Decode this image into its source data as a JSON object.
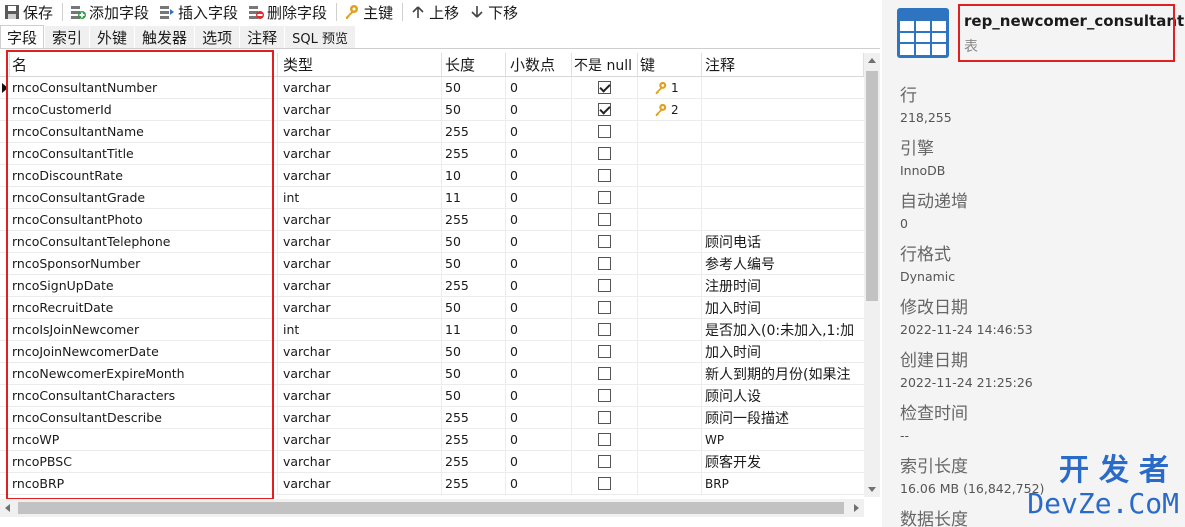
{
  "toolbar": {
    "save": "保存",
    "add_field": "添加字段",
    "insert_field": "插入字段",
    "delete_field": "删除字段",
    "primary_key": "主键",
    "move_up": "上移",
    "move_down": "下移"
  },
  "tabs": [
    "字段",
    "索引",
    "外键",
    "触发器",
    "选项",
    "注释",
    "SQL 预览"
  ],
  "columns": {
    "name": "名",
    "type": "类型",
    "length": "长度",
    "decimals": "小数点",
    "not_null": "不是 null",
    "key": "键",
    "comment": "注释"
  },
  "rows": [
    {
      "name": "rncoConsultantNumber",
      "type": "varchar",
      "length": "50",
      "decimals": "0",
      "not_null": true,
      "key": "1",
      "comment": ""
    },
    {
      "name": "rncoCustomerId",
      "type": "varchar",
      "length": "50",
      "decimals": "0",
      "not_null": true,
      "key": "2",
      "comment": ""
    },
    {
      "name": "rncoConsultantName",
      "type": "varchar",
      "length": "255",
      "decimals": "0",
      "not_null": false,
      "key": "",
      "comment": ""
    },
    {
      "name": "rncoConsultantTitle",
      "type": "varchar",
      "length": "255",
      "decimals": "0",
      "not_null": false,
      "key": "",
      "comment": ""
    },
    {
      "name": "rncoDiscountRate",
      "type": "varchar",
      "length": "10",
      "decimals": "0",
      "not_null": false,
      "key": "",
      "comment": ""
    },
    {
      "name": "rncoConsultantGrade",
      "type": "int",
      "length": "11",
      "decimals": "0",
      "not_null": false,
      "key": "",
      "comment": ""
    },
    {
      "name": "rncoConsultantPhoto",
      "type": "varchar",
      "length": "255",
      "decimals": "0",
      "not_null": false,
      "key": "",
      "comment": ""
    },
    {
      "name": "rncoConsultantTelephone",
      "type": "varchar",
      "length": "50",
      "decimals": "0",
      "not_null": false,
      "key": "",
      "comment": "顾问电话"
    },
    {
      "name": "rncoSponsorNumber",
      "type": "varchar",
      "length": "50",
      "decimals": "0",
      "not_null": false,
      "key": "",
      "comment": "参考人编号"
    },
    {
      "name": "rncoSignUpDate",
      "type": "varchar",
      "length": "255",
      "decimals": "0",
      "not_null": false,
      "key": "",
      "comment": "注册时间"
    },
    {
      "name": "rncoRecruitDate",
      "type": "varchar",
      "length": "50",
      "decimals": "0",
      "not_null": false,
      "key": "",
      "comment": "加入时间"
    },
    {
      "name": "rncoIsJoinNewcomer",
      "type": "int",
      "length": "11",
      "decimals": "0",
      "not_null": false,
      "key": "",
      "comment": "是否加入(0:未加入,1:加"
    },
    {
      "name": "rncoJoinNewcomerDate",
      "type": "varchar",
      "length": "50",
      "decimals": "0",
      "not_null": false,
      "key": "",
      "comment": "加入时间"
    },
    {
      "name": "rncoNewcomerExpireMonth",
      "type": "varchar",
      "length": "50",
      "decimals": "0",
      "not_null": false,
      "key": "",
      "comment": "新人到期的月份(如果注"
    },
    {
      "name": "rncoConsultantCharacters",
      "type": "varchar",
      "length": "50",
      "decimals": "0",
      "not_null": false,
      "key": "",
      "comment": "顾问人设"
    },
    {
      "name": "rncoConsultantDescribe",
      "type": "varchar",
      "length": "255",
      "decimals": "0",
      "not_null": false,
      "key": "",
      "comment": "顾问一段描述"
    },
    {
      "name": "rncoWP",
      "type": "varchar",
      "length": "255",
      "decimals": "0",
      "not_null": false,
      "key": "",
      "comment": "WP"
    },
    {
      "name": "rncoPBSC",
      "type": "varchar",
      "length": "255",
      "decimals": "0",
      "not_null": false,
      "key": "",
      "comment": "顾客开发"
    },
    {
      "name": "rncoBRP",
      "type": "varchar",
      "length": "255",
      "decimals": "0",
      "not_null": false,
      "key": "",
      "comment": "BRP"
    }
  ],
  "object": {
    "name": "rep_newcomer_consultant",
    "type": "表"
  },
  "properties": [
    {
      "label": "行",
      "value": "218,255"
    },
    {
      "label": "引擎",
      "value": "InnoDB"
    },
    {
      "label": "自动递增",
      "value": "0"
    },
    {
      "label": "行格式",
      "value": "Dynamic"
    },
    {
      "label": "修改日期",
      "value": "2022-11-24 14:46:53"
    },
    {
      "label": "创建日期",
      "value": "2022-11-24 21:25:26"
    },
    {
      "label": "检查时间",
      "value": "--"
    },
    {
      "label": "索引长度",
      "value": "16.06 MB (16,842,752)"
    },
    {
      "label": "数据长度",
      "value": ""
    }
  ],
  "watermark": {
    "line1": "开发者",
    "line2": "DevZe.CoM"
  },
  "colors": {
    "highlight_box": "#e02020",
    "table_icon": "#2f74c0",
    "key_icon": "#e0a020"
  }
}
